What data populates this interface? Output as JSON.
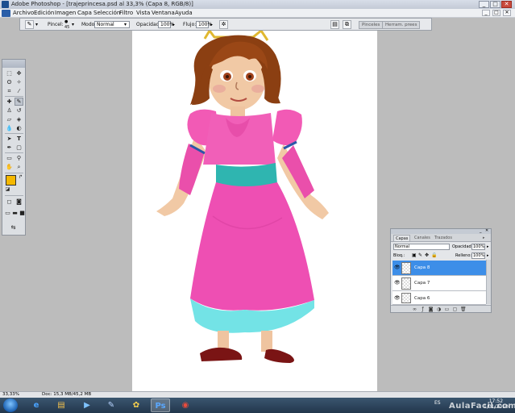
{
  "window": {
    "title": "Adobe Photoshop - [trajeprincesa.psd al 33,3% (Capa 8, RGB/8)]",
    "controls": [
      "_",
      "□",
      "✕"
    ]
  },
  "menu": {
    "items": [
      "Archivo",
      "Edición",
      "Imagen",
      "Capa",
      "Selección",
      "Filtro",
      "Vista",
      "Ventana",
      "Ayuda"
    ],
    "doc_controls": [
      "_",
      "□",
      "✕"
    ]
  },
  "options_bar": {
    "brush_label": "Pincel:",
    "brush_size": "45",
    "mode_label": "Modo:",
    "mode_value": "Normal",
    "opacity_label": "Opacidad:",
    "opacity_value": "100%",
    "flow_label": "Flujo:",
    "flow_value": "100%",
    "well_tabs": [
      "Pinceles",
      "Herram. prees"
    ]
  },
  "layers_panel": {
    "tabs": [
      "Capas",
      "Canales",
      "Trazados"
    ],
    "blend_mode": "Normal",
    "opacity_label": "Opacidad:",
    "opacity_value": "100%",
    "lock_label": "Bloq.:",
    "fill_label": "Relleno:",
    "fill_value": "100%",
    "layers": [
      {
        "name": "Capa 8",
        "selected": true,
        "visible": true
      },
      {
        "name": "Capa 7",
        "selected": false,
        "visible": true
      },
      {
        "name": "Capa 6",
        "selected": false,
        "visible": true
      }
    ]
  },
  "status_bar": {
    "zoom": "33,33%",
    "doc_info": "Doc: 15,3 MB/45,2 MB"
  },
  "taskbar": {
    "language": "ES",
    "time": "17:52",
    "date": "1/01/2010",
    "watermark": "AulaFacil.com"
  },
  "colors": {
    "foreground": "#f5b800",
    "background": "#ffffff",
    "selected_layer": "#3d8ee8"
  }
}
